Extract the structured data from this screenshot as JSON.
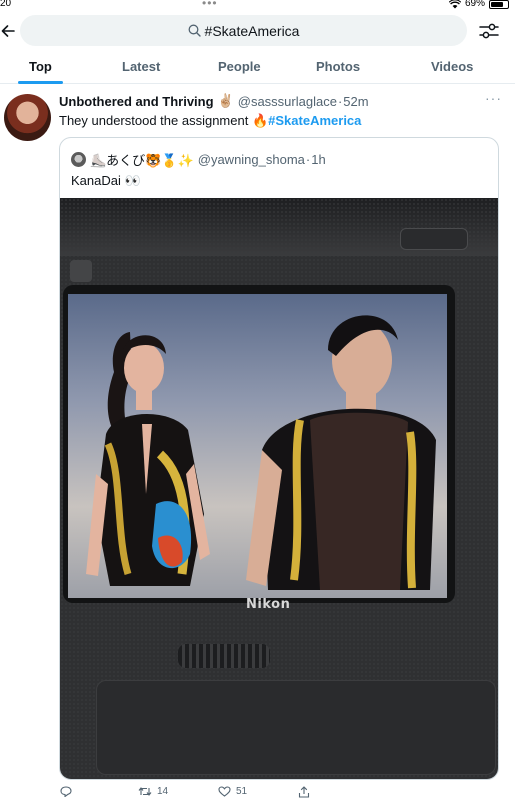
{
  "status": {
    "time": "20",
    "battery": "69%"
  },
  "search": {
    "query": "#SkateAmerica"
  },
  "tabs": [
    {
      "label": "Top",
      "active": true
    },
    {
      "label": "Latest",
      "active": false
    },
    {
      "label": "People",
      "active": false
    },
    {
      "label": "Photos",
      "active": false
    },
    {
      "label": "Videos",
      "active": false
    }
  ],
  "tweet": {
    "author_name": "Unbothered and Thriving",
    "author_emoji": "✌🏼",
    "handle": "@sasssurlaglace",
    "time": "52m",
    "separator": "·",
    "text_prefix": "They understood the assignment",
    "text_emoji": "🔥",
    "hashtag": "#SkateAmerica",
    "more": "···",
    "quoted": {
      "author_name": "⛸️あくび🐯🥇✨",
      "handle": "@yawning_shoma",
      "time": "1h",
      "text": "KanaDai 👀",
      "photo_brand": "Nikon"
    },
    "actions": {
      "reply_count": "",
      "retweet_count": "14",
      "like_count": "51"
    }
  },
  "colors": {
    "accent": "#1d9bf0",
    "muted_text": "#536471",
    "search_bg": "#eff3f4"
  },
  "icons": [
    "back-arrow-icon",
    "search-icon",
    "filter-icon",
    "more-icon",
    "reply-icon",
    "retweet-icon",
    "like-icon",
    "share-icon"
  ]
}
